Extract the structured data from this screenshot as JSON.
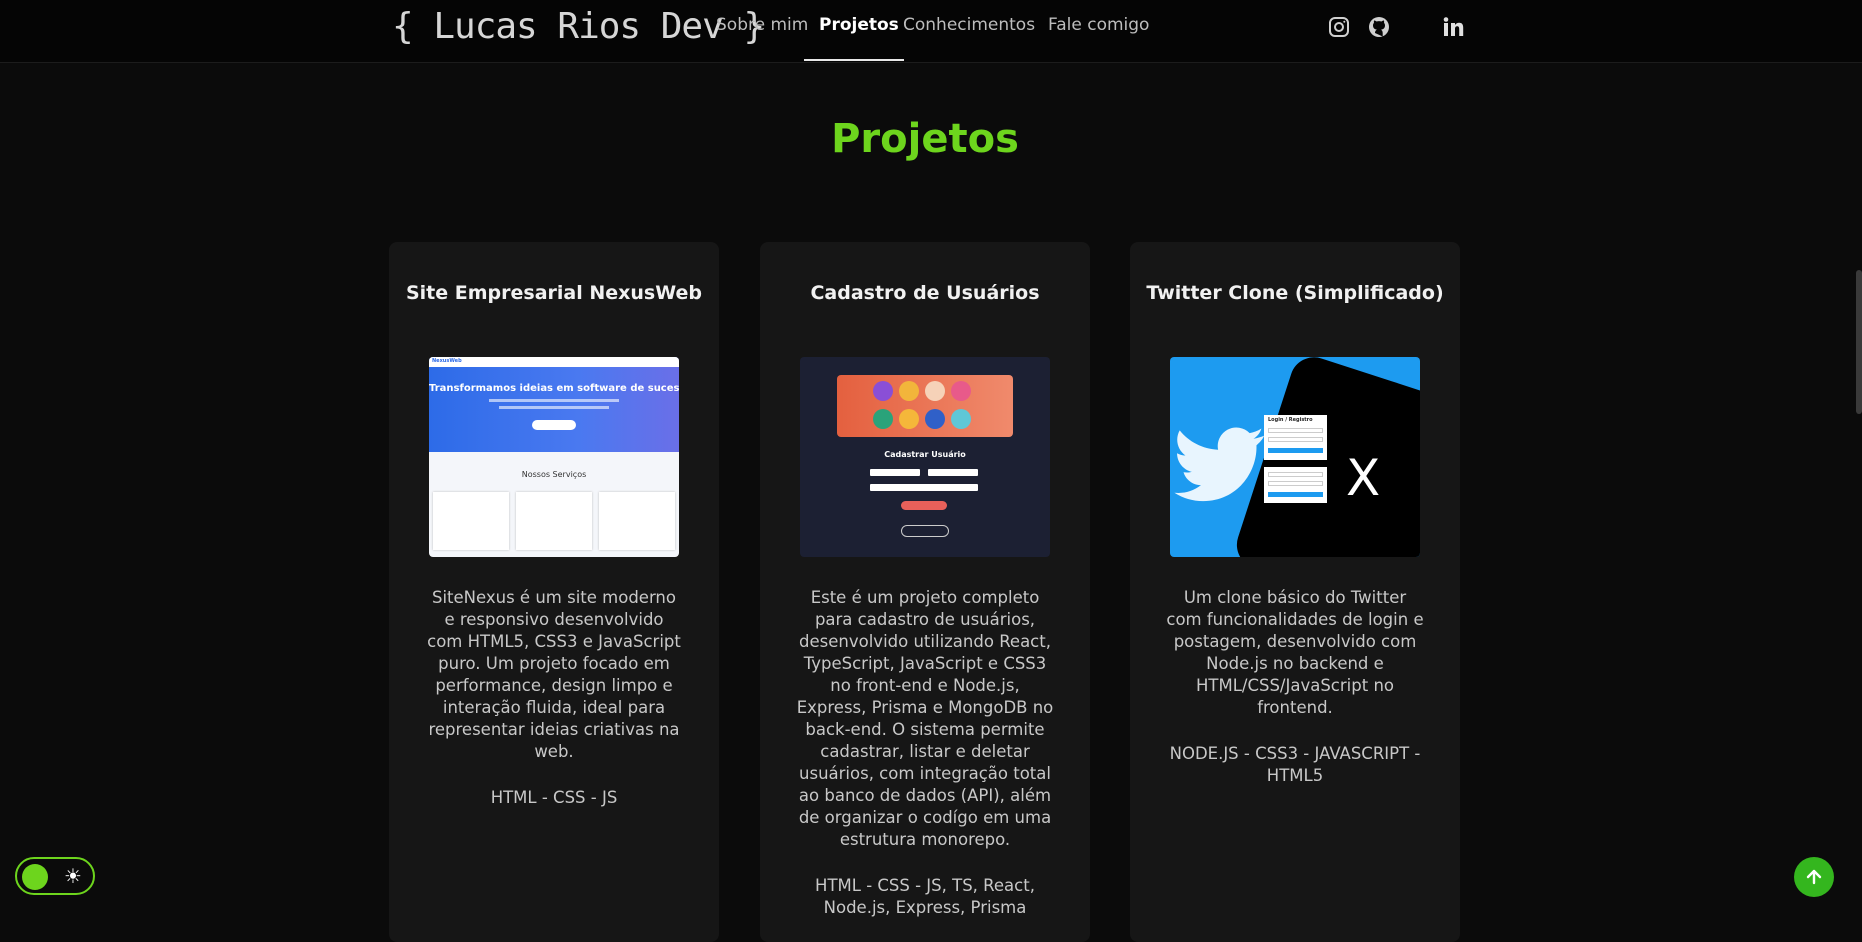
{
  "nav": {
    "logo": "{ Lucas Rios Dev }",
    "links": [
      "Sobre mim",
      "Projetos",
      "Conhecimentos",
      "Fale comigo"
    ],
    "active_index": 1,
    "social_icons": [
      "instagram-icon",
      "github-icon",
      "linkedin-icon"
    ]
  },
  "section": {
    "title": "Projetos"
  },
  "projects": [
    {
      "title": "Site Empresarial NexusWeb",
      "description": "SiteNexus é um site moderno e responsivo desenvolvido com HTML5, CSS3 e JavaScript puro. Um projeto focado em performance, design limpo e interação fluida, ideal para representar ideias criativas na web.",
      "tags": "HTML - CSS - JS",
      "thumb": {
        "brand": "NexusWeb",
        "headline": "Transformamos ideias em software de sucesso",
        "services_title": "Nossos Serviços"
      }
    },
    {
      "title": "Cadastro de Usuários",
      "description": "Este é um projeto completo para cadastro de usuários, desenvolvido utilizando React, TypeScript, JavaScript e CSS3 no front-end e Node.js, Express, Prisma e MongoDB no back-end. O sistema permite cadastrar, listar e deletar usuários, com integração total ao banco de dados (API), além de organizar o codígo em uma estrutura monorepo.",
      "tags": "HTML - CSS - JS, TS, React, Node.js, Express, Prisma",
      "thumb": {
        "form_title": "Cadastrar Usuário"
      }
    },
    {
      "title": "Twitter Clone (Simplificado)",
      "description": "Um clone básico do Twitter com funcionalidades de login e postagem, desenvolvido com Node.js no backend e HTML/CSS/JavaScript no frontend.",
      "tags": "NODE.JS - CSS3 - JAVASCRIPT - HTML5",
      "thumb": {
        "login_title": "Login / Registro",
        "x_glyph": "X"
      }
    }
  ],
  "colors": {
    "accent": "#6dd51d",
    "background": "#0b0b0b",
    "card": "#161616",
    "back_to_top": "#34b61e"
  },
  "controls": {
    "theme_icon": "sun-icon",
    "back_to_top_icon": "arrow-up-icon"
  }
}
